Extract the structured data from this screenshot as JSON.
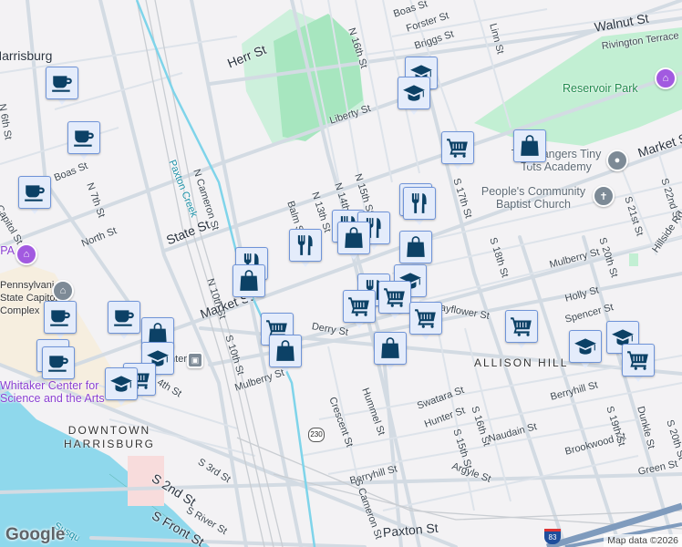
{
  "map": {
    "attribution": "Map data ©2026",
    "logo": "Google",
    "route_shield": "230",
    "interstate_shield": "83"
  },
  "labels": {
    "harrisburg": "Harrisburg",
    "n6th": "N 6th St",
    "n7th": "N 7th St",
    "boas_w": "Boas St",
    "capitol": "Capitol St",
    "north": "North St",
    "herr": "Herr St",
    "paxton_creek": "Paxton Creek",
    "n_cameron": "N Cameron St",
    "state_w": "State St",
    "n10th": "N 10th St",
    "market_w": "Market St",
    "s10th": "S 10th St",
    "derry": "Derry St",
    "mulberry_w": "Mulberry St",
    "balm": "Balm St",
    "n13th": "N 13th St",
    "n14th": "N 14th St",
    "n15th": "N 15th St",
    "n16th": "N 16th St",
    "liberty": "Liberty St",
    "boas_e": "Boas St",
    "forster": "Forster St",
    "briggs": "Briggs St",
    "linn": "Linn St",
    "walnut": "Walnut St",
    "rivington": "Rivington Terrace",
    "reservoir": "Reservoir Park",
    "tiny_tots": "The Rangers Tiny Tots Academy",
    "church": "People's Community Baptist Church",
    "market_e": "Market St",
    "s17th": "S 17th St",
    "s18th": "S 18th St",
    "s20th": "S 20th St",
    "s21st": "S 21st St",
    "s22nd": "S 22nd St",
    "hillside": "Hillside Rd",
    "mulberry_e": "Mulberry St",
    "holly": "Holly St",
    "spencer": "Spencer St",
    "mayflower": "Mayflower St",
    "allison_hill": "ALLISON HILL",
    "crescent": "Crescent St",
    "hummel": "Hummel St",
    "swatara": "Swatara St",
    "hunter": "Hunter St",
    "s15th": "S 15th St",
    "s16th": "S 16th St",
    "berryhill_e": "Berryhill St",
    "berryhill_w": "Berryhill St",
    "naudain": "Naudain St",
    "argyle": "Argyle St",
    "brookwood": "Brookwood St",
    "s19th": "S 19th St",
    "dunkle": "Dunkle St",
    "s20th_b": "S 20th St",
    "green": "Green St",
    "paxton_st": "Paxton St",
    "s_cameron": "S Cameron St",
    "state_complex": "Pennsylvania State Capitol Complex",
    "whitaker": "Whitaker Center for Science and the Arts",
    "downtown": "DOWNTOWN HARRISBURG",
    "s2nd": "S 2nd St",
    "s3rd": "S 3rd St",
    "s_front": "S Front St",
    "s_river": "S River St",
    "s4th": "S 4th St",
    "station": "Harrisburg Transportation Center",
    "spa": "SPA",
    "susquehanna": "Susquehanna River"
  },
  "markers": [
    {
      "icon": "coffee"
    },
    {
      "icon": "coffee"
    },
    {
      "icon": "coffee"
    },
    {
      "icon": "coffee"
    },
    {
      "icon": "coffee"
    },
    {
      "icon": "coffee"
    },
    {
      "icon": "coffee"
    },
    {
      "icon": "shopping"
    },
    {
      "icon": "education"
    },
    {
      "icon": "cart"
    },
    {
      "icon": "education"
    },
    {
      "icon": "restaurant"
    },
    {
      "icon": "shopping"
    },
    {
      "icon": "cart"
    },
    {
      "icon": "shopping"
    },
    {
      "icon": "restaurant"
    },
    {
      "icon": "education"
    },
    {
      "icon": "education"
    },
    {
      "icon": "cart"
    },
    {
      "icon": "shopping"
    },
    {
      "icon": "restaurant"
    },
    {
      "icon": "restaurant"
    },
    {
      "icon": "restaurant"
    },
    {
      "icon": "restaurant"
    },
    {
      "icon": "shopping"
    },
    {
      "icon": "shopping"
    },
    {
      "icon": "education"
    },
    {
      "icon": "restaurant"
    },
    {
      "icon": "cart"
    },
    {
      "icon": "cart"
    },
    {
      "icon": "cart"
    },
    {
      "icon": "shopping"
    },
    {
      "icon": "cart"
    },
    {
      "icon": "education"
    },
    {
      "icon": "education"
    },
    {
      "icon": "cart"
    }
  ]
}
